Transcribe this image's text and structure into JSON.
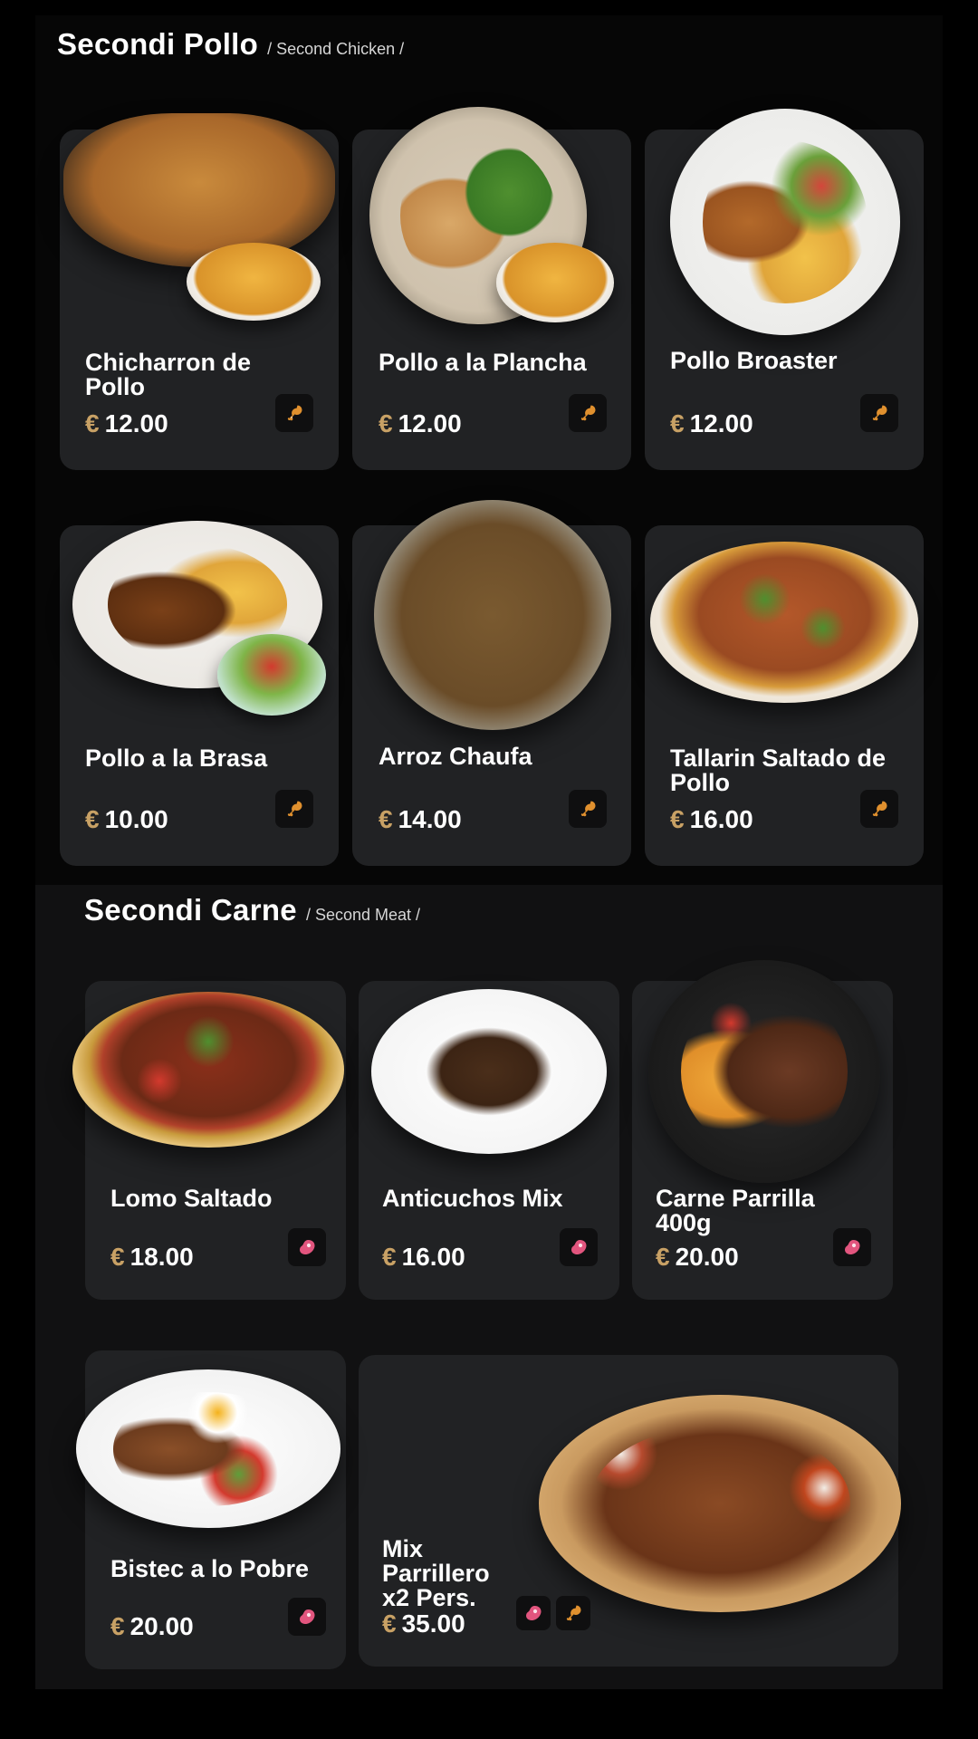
{
  "chicken_section": {
    "title": "Secondi Pollo",
    "subtitle": "/ Second Chicken /",
    "items": [
      {
        "name": "Chicharron de Pollo",
        "currency": "€",
        "price": "12.00",
        "icon": "drumstick-icon"
      },
      {
        "name": "Pollo a la Plancha",
        "currency": "€",
        "price": "12.00",
        "icon": "drumstick-icon"
      },
      {
        "name": "Pollo Broaster",
        "currency": "€",
        "price": "12.00",
        "icon": "drumstick-icon"
      },
      {
        "name": "Pollo a la Brasa",
        "currency": "€",
        "price": "10.00",
        "icon": "drumstick-icon"
      },
      {
        "name": "Arroz Chaufa",
        "currency": "€",
        "price": "14.00",
        "icon": "drumstick-icon"
      },
      {
        "name": "Tallarin Saltado de Pollo",
        "currency": "€",
        "price": "16.00",
        "icon": "drumstick-icon"
      }
    ]
  },
  "meat_section": {
    "title": "Secondi Carne",
    "subtitle": "/ Second Meat /",
    "items": [
      {
        "name": "Lomo Saltado",
        "currency": "€",
        "price": "18.00",
        "icon": "steak-icon"
      },
      {
        "name": "Anticuchos Mix",
        "currency": "€",
        "price": "16.00",
        "icon": "steak-icon"
      },
      {
        "name": "Carne Parrilla 400g",
        "currency": "€",
        "price": "20.00",
        "icon": "steak-icon"
      },
      {
        "name": "Bistec a lo Pobre",
        "currency": "€",
        "price": "20.00",
        "icon": "steak-icon"
      },
      {
        "name": "Mix Parrillero x2 Pers.",
        "currency": "€",
        "price": "35.00",
        "icons": [
          "steak-icon",
          "drumstick-icon"
        ]
      }
    ]
  },
  "colors": {
    "background": "#000000",
    "card": "#212224",
    "currency_gold": "#c8a165",
    "drumstick_orange": "#e0902e",
    "steak_pink": "#e2557e"
  }
}
